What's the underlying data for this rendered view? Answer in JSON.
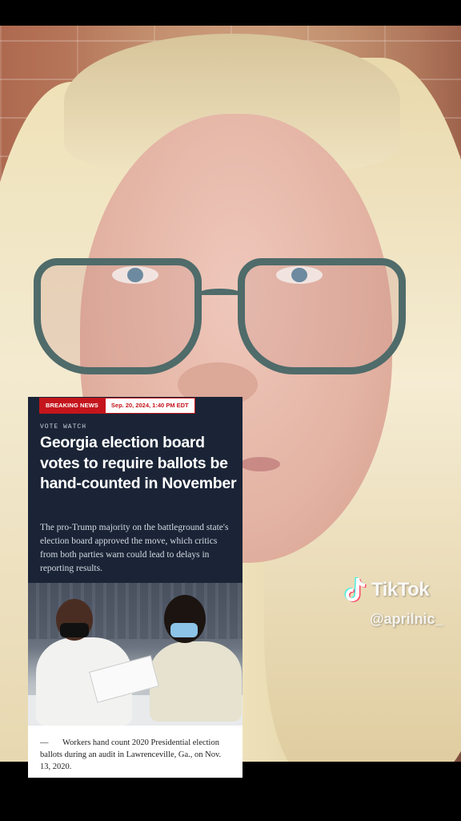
{
  "article": {
    "badge_breaking": "BREAKING NEWS",
    "badge_date": "Sep. 20, 2024, 1:40 PM EDT",
    "kicker": "VOTE WATCH",
    "headline": "Georgia election board votes to require ballots be hand-counted in November",
    "dek": "The pro-Trump majority on the battleground state's election board approved the move, which critics from both parties warn could lead to delays in reporting results.",
    "caption": "Workers hand count 2020 Presidential election ballots during an audit in Lawrenceville, Ga., on Nov. 13, 2020."
  },
  "watermark": {
    "brand": "TikTok",
    "username": "@aprilnic_",
    "icon": "tiktok-note-icon"
  },
  "colors": {
    "breaking_red": "#c4151c",
    "card_navy": "#1a2436"
  }
}
